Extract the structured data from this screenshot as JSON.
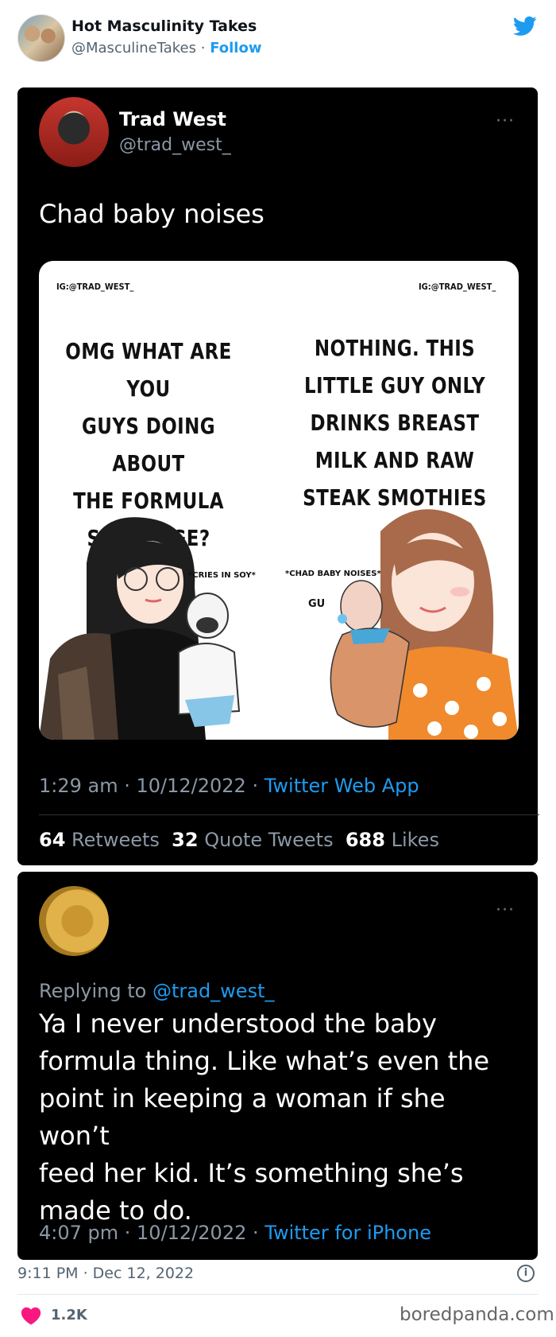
{
  "header": {
    "author_name": "Hot Masculinity Takes",
    "author_handle": "@MasculineTakes",
    "separator": " · ",
    "follow_label": "Follow",
    "brand_icon": "twitter-bird-icon",
    "accent_color": "#1d9bf0"
  },
  "tweet": {
    "name": "Trad West",
    "handle": "@trad_west_",
    "more_icon": "···",
    "text": "Chad baby noises",
    "meme": {
      "ig_left": "IG:@TRAD_WEST_",
      "ig_right": "IG:@TRAD_WEST_",
      "ig_side": "IG:@TRAD_WEST_",
      "left_text": [
        "OMG WHAT ARE YOU",
        "GUYS DOING ABOUT",
        "THE FORMULA",
        "SHORTAGE?"
      ],
      "right_text": [
        "NOTHING. THIS",
        "LITTLE GUY ONLY",
        "DRINKS BREAST",
        "MILK AND RAW",
        "STEAK SMOTHIES"
      ],
      "left_caption": "*CRIES IN SOY*",
      "right_caption": "*CHAD BABY NOISES*",
      "baby_sound": "GU"
    },
    "time": "1:29 am",
    "date": "10/12/2022",
    "app": "Twitter Web App",
    "retweets": "64",
    "retweets_label": "Retweets",
    "quotes": "32",
    "quotes_label": "Quote Tweets",
    "likes": "688",
    "likes_label": "Likes"
  },
  "reply": {
    "more_icon": "···",
    "replying_label": "Replying to",
    "replying_handle": "@trad_west_",
    "lines": [
      "Ya I never understood the baby",
      "formula thing. Like what’s even the",
      "point in keeping a woman if she won’t",
      "feed her kid. It’s something she’s",
      "made to do."
    ],
    "time": "4:07 pm",
    "date": "10/12/2022",
    "app": "Twitter for iPhone"
  },
  "footer": {
    "timestamp": "9:11 PM · Dec 12, 2022",
    "info_icon": "i",
    "likes": "1.2K",
    "brand": "boredpanda.com"
  }
}
